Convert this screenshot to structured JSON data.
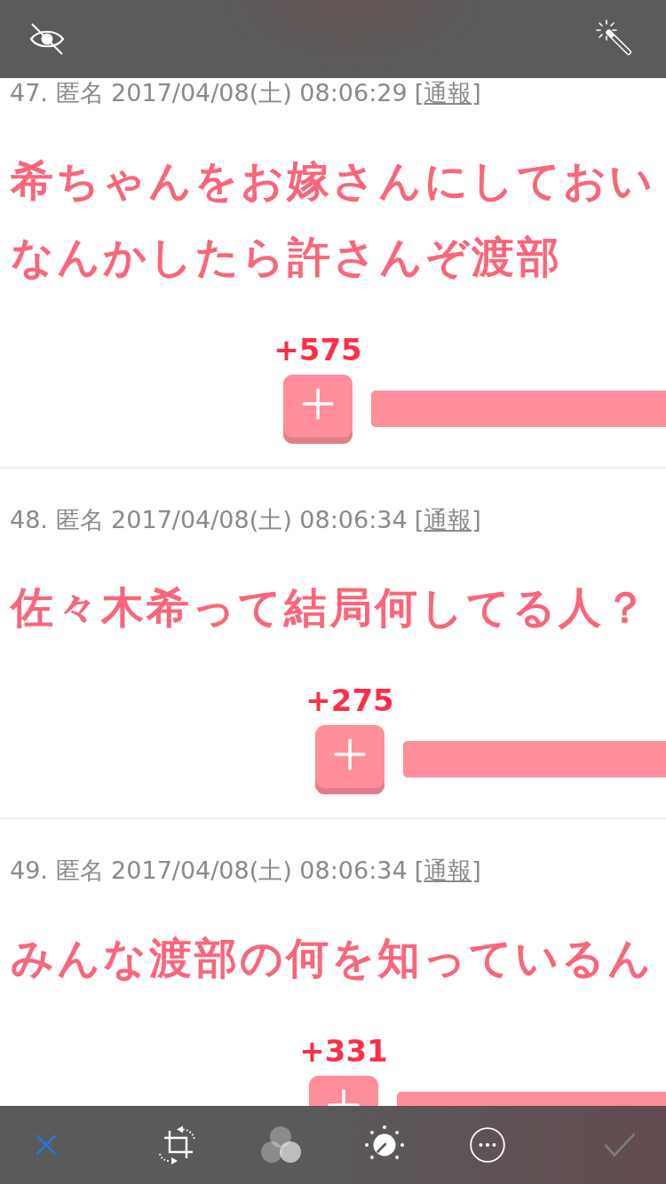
{
  "posts": [
    {
      "meta": "47. 匿名 2017/04/08(土) 08:06:29",
      "report": {
        "before": "[",
        "label": "通報",
        "after": "]"
      },
      "lines": [
        "希ちゃんをお嫁さんにしておい",
        "なんかしたら許さんぞ渡部"
      ],
      "score": "+575"
    },
    {
      "meta": "48. 匿名 2017/04/08(土) 08:06:34",
      "report": {
        "before": "[",
        "label": "通報",
        "after": "]"
      },
      "lines": [
        "佐々木希って結局何してる人？"
      ],
      "score": "+275"
    },
    {
      "meta": "49. 匿名 2017/04/08(土) 08:06:34",
      "report": {
        "before": "[",
        "label": "通報",
        "after": "]"
      },
      "lines": [
        "みんな渡部の何を知っているん"
      ],
      "score": "+331"
    }
  ],
  "done_button": {
    "disabled": true
  }
}
